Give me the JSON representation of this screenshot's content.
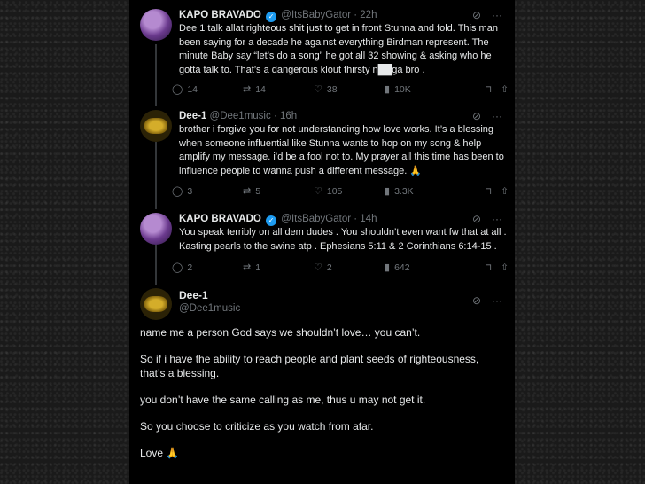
{
  "tweets": [
    {
      "name": "KAPO BRAVADO",
      "handle": "@ItsBabyGator",
      "time": "· 22h",
      "text": "Dee 1 talk allat righteous shit just to get in front Stunna and fold. This man been saying for a decade he against everything Birdman represent. The minute Baby say “let’s do a song” he got all 32 showing & asking who he gotta talk to. That’s a dangerous klout thirsty n██ga bro .",
      "replies": "14",
      "reposts": "14",
      "likes": "38",
      "views": "10K"
    },
    {
      "name": "Dee-1",
      "handle": "@Dee1music",
      "time": "· 16h",
      "text": "brother i forgive you for not understanding how love works. It’s a blessing when someone influential like Stunna wants to hop on my song & help amplify my message. i’d be a fool not to. My prayer all this time has been to influence people to wanna push a different message. 🙏",
      "replies": "3",
      "reposts": "5",
      "likes": "105",
      "views": "3.3K"
    },
    {
      "name": "KAPO BRAVADO",
      "handle": "@ItsBabyGator",
      "time": "· 14h",
      "text": "You speak terribly on all dem dudes . You shouldn’t even want fw that at all . Kasting pearls to the swine atp . Ephesians 5:11 & 2 Corinthians 6:14-15 .",
      "replies": "2",
      "reposts": "1",
      "likes": "2",
      "views": "642"
    }
  ],
  "main": {
    "name": "Dee-1",
    "handle": "@Dee1music",
    "paragraphs": [
      "name me a person God says we shouldn’t love… you can’t.",
      "So if i have the ability to reach people and plant seeds of righteousness, that’s a blessing.",
      "you don’t have the same calling as me, thus u may not get it.",
      "So you choose to criticize as you watch from afar.",
      "Love 🙏"
    ]
  },
  "icons": {
    "reply": "reply-icon",
    "repost": "repost-icon",
    "like": "heart-icon",
    "views": "views-icon",
    "bookmark": "bookmark-icon",
    "share": "share-icon",
    "grok": "grok-icon",
    "more": "more-icon"
  },
  "colors": {
    "verified": "#1d9bf0",
    "muted": "#71767b",
    "background": "#000000"
  }
}
